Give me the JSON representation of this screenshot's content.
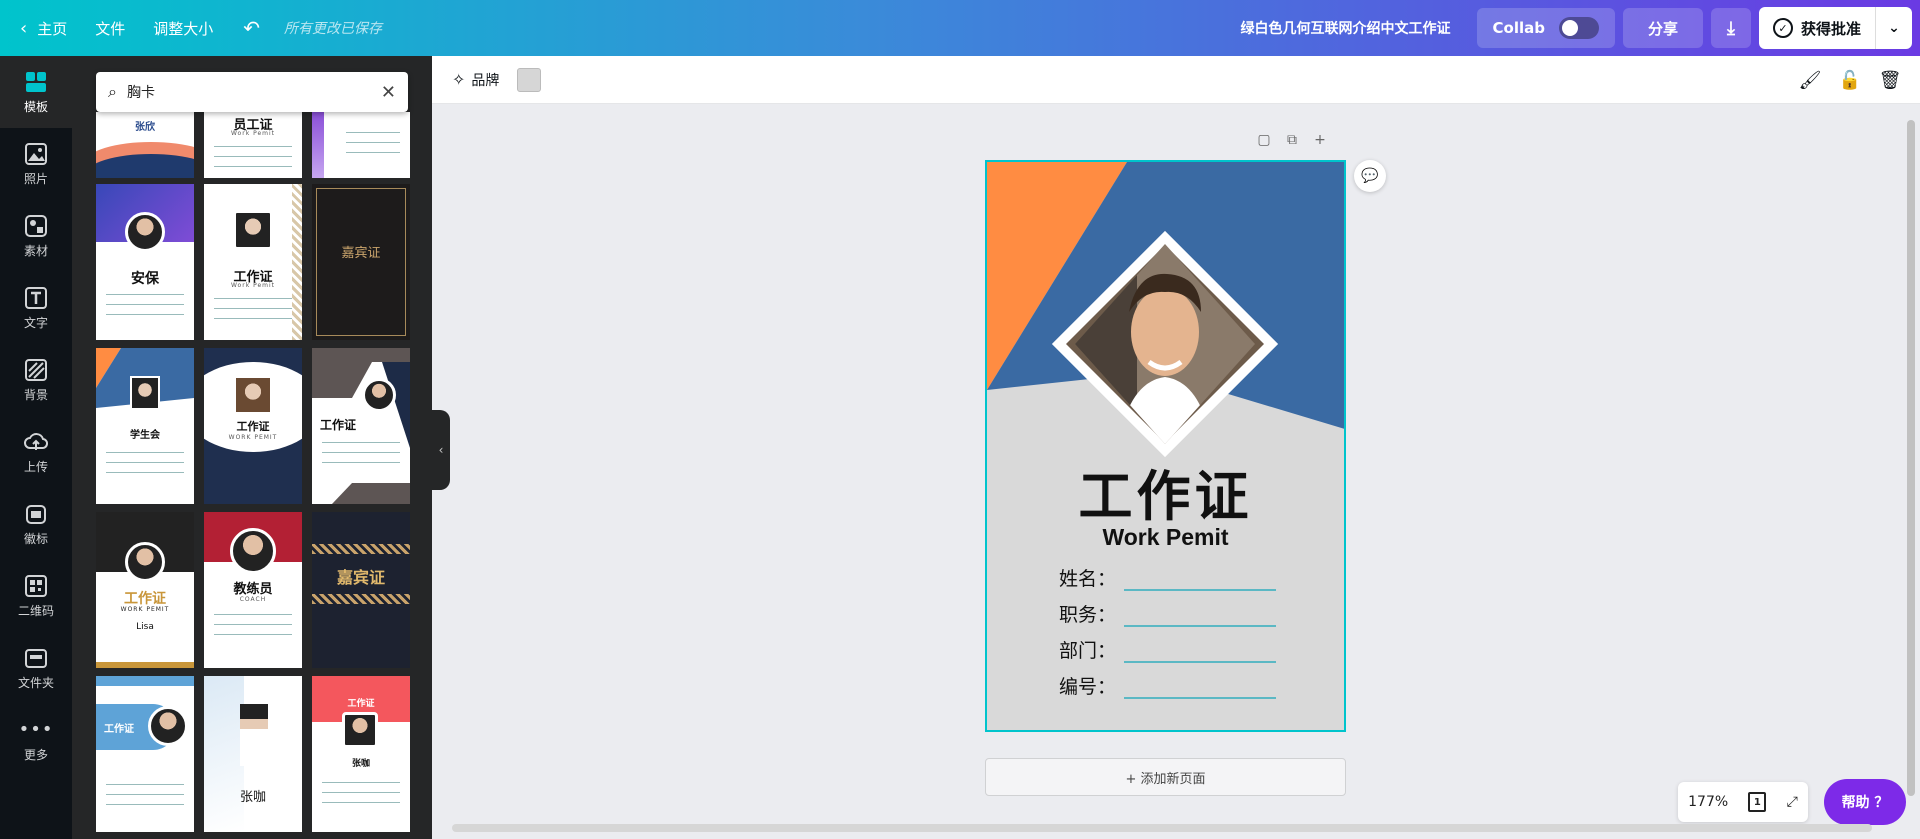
{
  "topbar": {
    "home": "主页",
    "file": "文件",
    "resize": "调整大小",
    "saved": "所有更改已保存",
    "title": "绿白色几何互联网介绍中文工作证",
    "collab": "Collab",
    "share": "分享",
    "approve": "获得批准"
  },
  "rail": [
    {
      "label": "模板"
    },
    {
      "label": "照片"
    },
    {
      "label": "素材"
    },
    {
      "label": "文字"
    },
    {
      "label": "背景"
    },
    {
      "label": "上传"
    },
    {
      "label": "徽标"
    },
    {
      "label": "二维码"
    },
    {
      "label": "文件夹"
    },
    {
      "label": "更多"
    }
  ],
  "search": {
    "value": "胸卡"
  },
  "templates": {
    "t0": "张欣",
    "t1": "员工证",
    "t1s": "Work Pemit",
    "t3": "安保",
    "t4": "工作证",
    "t4s": "Work Pemit",
    "t5": "嘉宾证",
    "t6": "学生会",
    "t7": "工作证",
    "t7s": "WORK PEMIT",
    "t8": "工作证",
    "t9": "工作证",
    "t9s": "WORK PEMIT",
    "t9n": "Lisa",
    "t10": "教练员",
    "t10s": "COACH",
    "t11": "嘉宾证",
    "t12": "工作证",
    "t13": "张咖",
    "t14": "工作证",
    "t14n": "张咖"
  },
  "canvas_toolbar": {
    "brand": "品牌"
  },
  "card": {
    "title": "工作证",
    "subtitle": "Work Pemit",
    "fields": [
      "姓名：",
      "职务：",
      "部门：",
      "编号："
    ],
    "colors": {
      "orange": "#ff8c42",
      "blue": "#3a6aa3",
      "grey": "#d9d9d9"
    }
  },
  "add_page": "+ 添加新页面",
  "zoom": "177%",
  "page_count": "1",
  "help": "帮助 ？"
}
